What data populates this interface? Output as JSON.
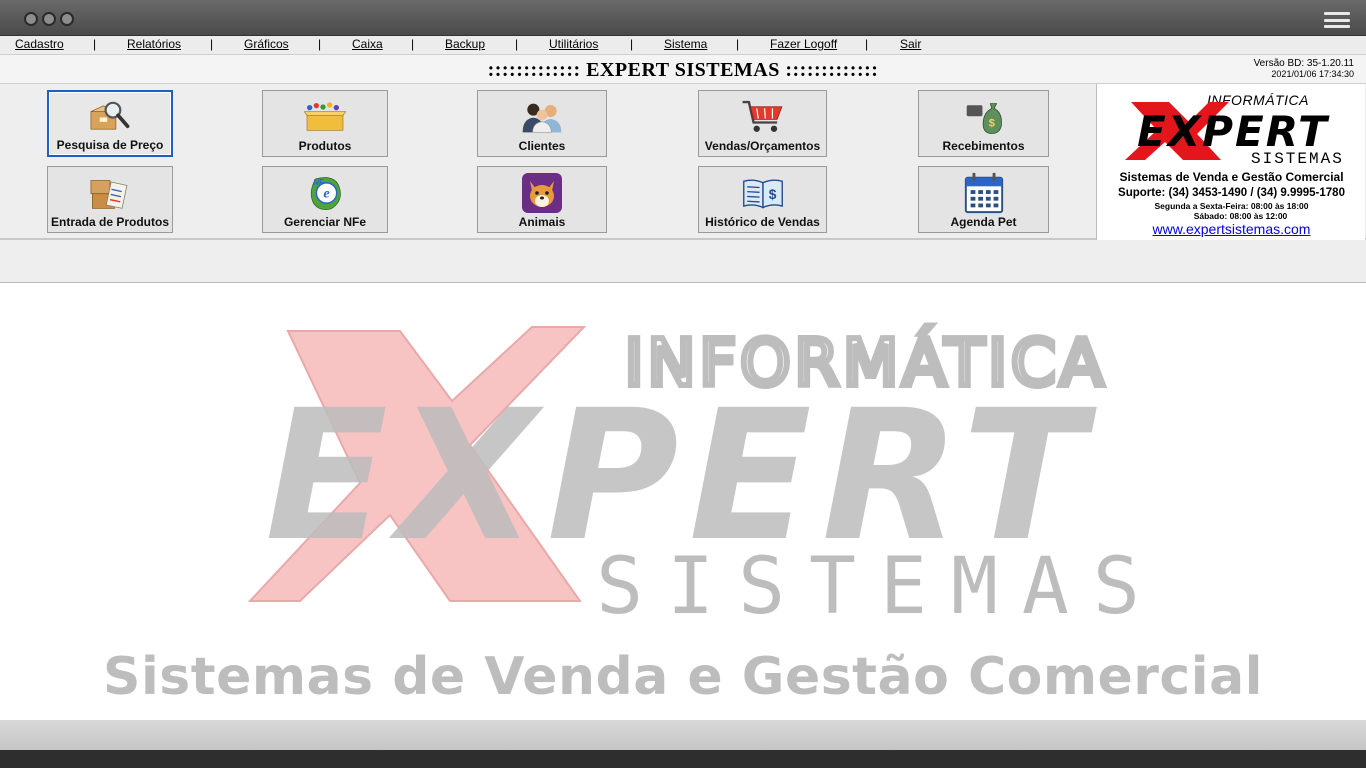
{
  "menu": {
    "items": [
      "Cadastro",
      "Relatórios",
      "Gráficos",
      "Caixa",
      "Backup",
      "Utilitários",
      "Sistema",
      "Fazer Logoff",
      "Sair"
    ],
    "separator": "|"
  },
  "header": {
    "title": "::::::::::::: EXPERT SISTEMAS :::::::::::::",
    "version": "Versão BD: 35-1.20.11",
    "datetime": "2021/01/06 17:34:30"
  },
  "toolbar": {
    "buttons": [
      {
        "label": "Pesquisa de Preço",
        "icon": "magnifier-box-icon",
        "active": true
      },
      {
        "label": "Produtos",
        "icon": "products-box-icon"
      },
      {
        "label": "Clientes",
        "icon": "clients-people-icon"
      },
      {
        "label": "Vendas/Orçamentos",
        "icon": "shopping-cart-icon"
      },
      {
        "label": "Recebimentos",
        "icon": "money-bag-icon"
      },
      {
        "label": "Entrada de Produtos",
        "icon": "clipboard-boxes-icon"
      },
      {
        "label": "Gerenciar NFe",
        "icon": "nfe-globe-icon"
      },
      {
        "label": "Animais",
        "icon": "dog-face-icon"
      },
      {
        "label": "Histórico de Vendas",
        "icon": "ledger-book-icon"
      },
      {
        "label": "Agenda Pet",
        "icon": "calendar-icon"
      }
    ]
  },
  "logo_box": {
    "informatica": "INFORMÁTICA",
    "expert": "EXPERT",
    "sistemas": "SISTEMAS",
    "tagline": "Sistemas de Venda e Gestão Comercial",
    "support": "Suporte: (34) 3453-1490 / (34) 9.9995-1780",
    "hours_weekday": "Segunda a Sexta-Feira: 08:00 às 18:00",
    "hours_saturday": "Sábado: 08:00 às 12:00",
    "website": "www.expertsistemas.com"
  },
  "watermark": {
    "informatica": "INFORMÁTICA",
    "expert": "EXPERT",
    "sistemas": "SISTEMAS",
    "tagline": "Sistemas de Venda e Gestão Comercial"
  },
  "colors": {
    "brand_red": "#e3161b",
    "watermark_red": "#f7c3c3",
    "watermark_gray": "#bdbdbd",
    "active_border": "#1e5fbf",
    "link": "#0000ee"
  }
}
